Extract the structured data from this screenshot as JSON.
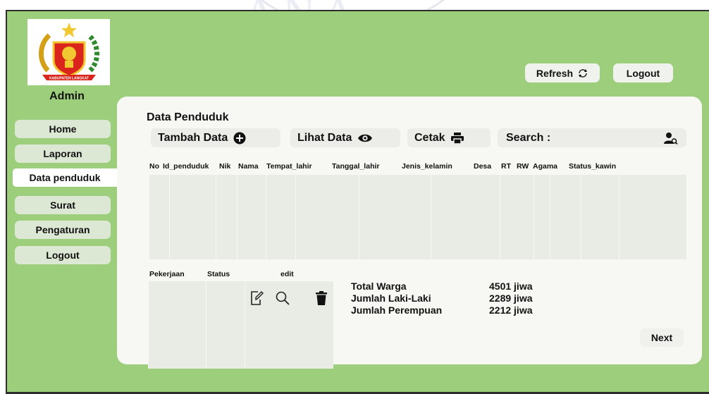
{
  "header": {
    "refresh_label": "Refresh",
    "logout_label": "Logout"
  },
  "logo": {
    "caption": "KABUPATEN LANGKAT"
  },
  "sidebar": {
    "title": "Admin",
    "items": [
      {
        "label": "Home",
        "active": false
      },
      {
        "label": "Laporan",
        "active": false
      },
      {
        "label": "Data penduduk",
        "active": true
      },
      {
        "label": "Surat",
        "active": false
      },
      {
        "label": "Pengaturan",
        "active": false
      },
      {
        "label": "Logout",
        "active": false
      }
    ]
  },
  "main": {
    "title": "Data Penduduk",
    "toolbar": {
      "add_label": "Tambah Data",
      "view_label": "Lihat Data",
      "print_label": "Cetak",
      "search_label": "Search :"
    },
    "table": {
      "columns": [
        "No",
        "Id_penduduk",
        "Nik",
        "Nama",
        "Tempat_lahir",
        "Tanggal_lahir",
        "Jenis_kelamin",
        "Desa",
        "RT",
        "RW",
        "Agama",
        "Status_kawin"
      ]
    },
    "table2": {
      "columns": [
        "Pekerjaan",
        "Status",
        "edit"
      ]
    },
    "summary": [
      {
        "label": "Total Warga",
        "value": "4501 jiwa"
      },
      {
        "label": "Jumlah Laki-Laki",
        "value": "2289 jiwa"
      },
      {
        "label": "Jumlah Perempuan",
        "value": "2212 jiwa"
      }
    ],
    "next_label": "Next"
  },
  "colors": {
    "frame_green": "#9cce7c",
    "nav_bg": "#dde8d4",
    "panel_bg": "#f7f7f4"
  }
}
